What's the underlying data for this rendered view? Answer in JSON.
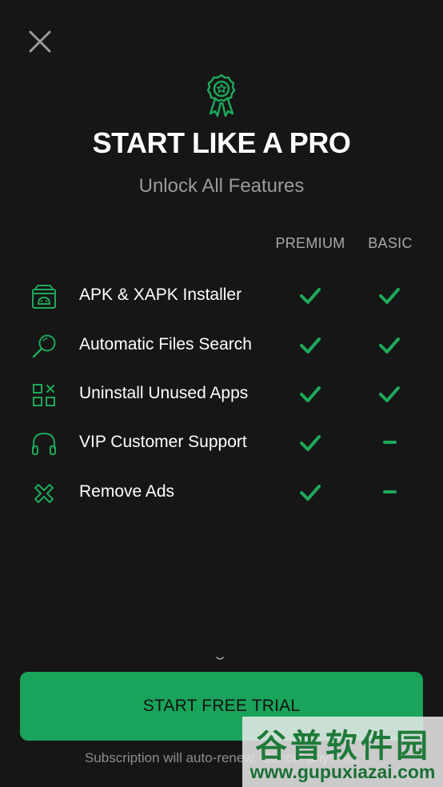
{
  "header": {
    "close_icon": "close-icon",
    "badge_icon": "award-badge-icon",
    "title": "START LIKE A PRO",
    "subtitle": "Unlock All Features"
  },
  "columns": {
    "premium": "PREMIUM",
    "basic": "BASIC"
  },
  "features": [
    {
      "label": "APK & XAPK Installer",
      "icon": "package-android-icon",
      "premium": "check",
      "basic": "check"
    },
    {
      "label": "Automatic Files Search",
      "icon": "magnifier-icon",
      "premium": "check",
      "basic": "check"
    },
    {
      "label": "Uninstall Unused Apps",
      "icon": "apps-grid-remove-icon",
      "premium": "check",
      "basic": "check"
    },
    {
      "label": "VIP Customer Support",
      "icon": "headset-icon",
      "premium": "check",
      "basic": "dash"
    },
    {
      "label": "Remove Ads",
      "icon": "remove-ads-x-icon",
      "premium": "check",
      "basic": "dash"
    }
  ],
  "cta": {
    "label": "START FREE TRIAL"
  },
  "footer": {
    "note": "Subscription will auto-renew. Cancel anytime."
  },
  "watermark": {
    "text_cn": "谷普软件园",
    "url": "www.gupuxiazai.com"
  },
  "colors": {
    "background": "#161616",
    "accent": "#1aa35a",
    "check": "#1ea85a"
  }
}
